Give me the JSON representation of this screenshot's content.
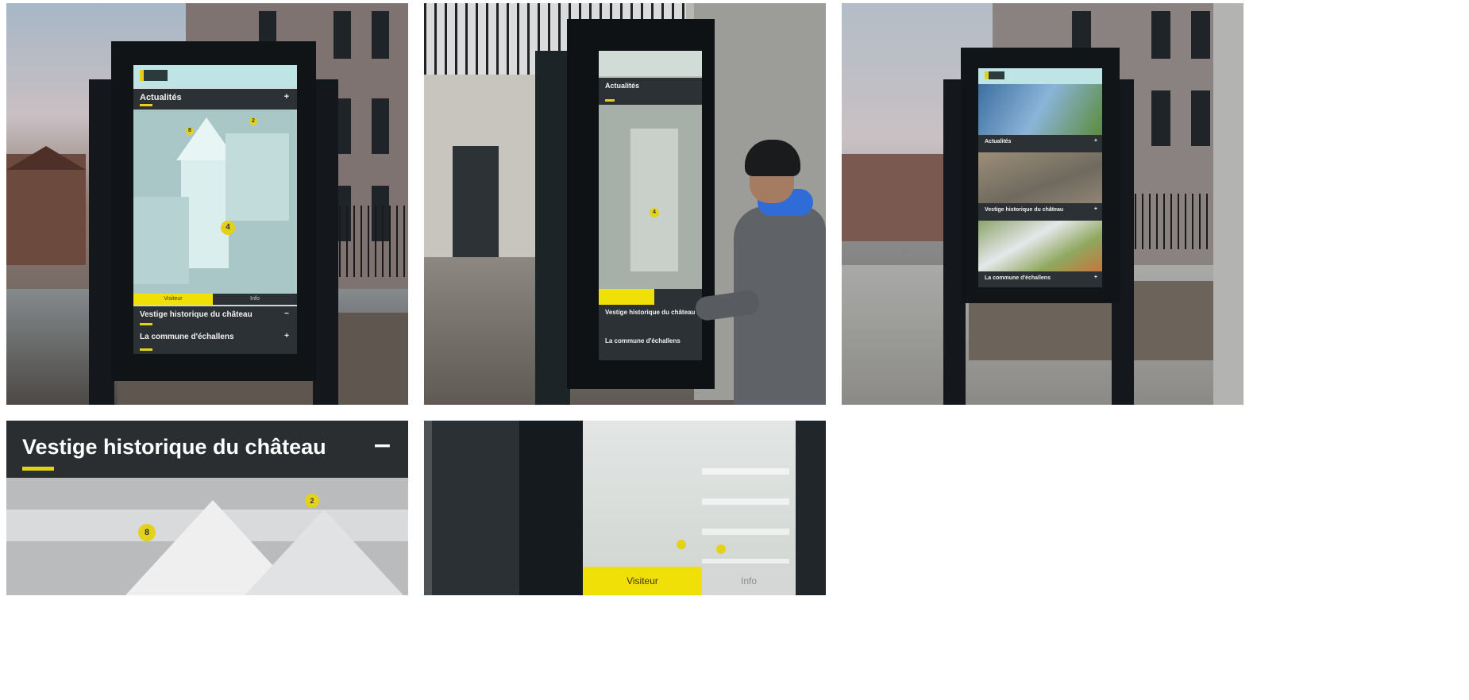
{
  "kiosk_menu": {
    "item1": "Actualités",
    "item2": "Vestige historique du château",
    "item3": "La commune d'échallens",
    "item3_short": "La commune d'échallens",
    "plus": "+",
    "minus": "−"
  },
  "map": {
    "pin_a": "8",
    "pin_b": "2",
    "pin_c": "4"
  },
  "buttons": {
    "visit": "Visiteur",
    "info": "Info"
  },
  "closeup": {
    "title": "Vestige historique du château",
    "collapse": "−"
  },
  "colors": {
    "accent_yellow": "#e3d21a",
    "bar_dark": "#2c3135",
    "screen_cyan": "#bfe4e6"
  }
}
